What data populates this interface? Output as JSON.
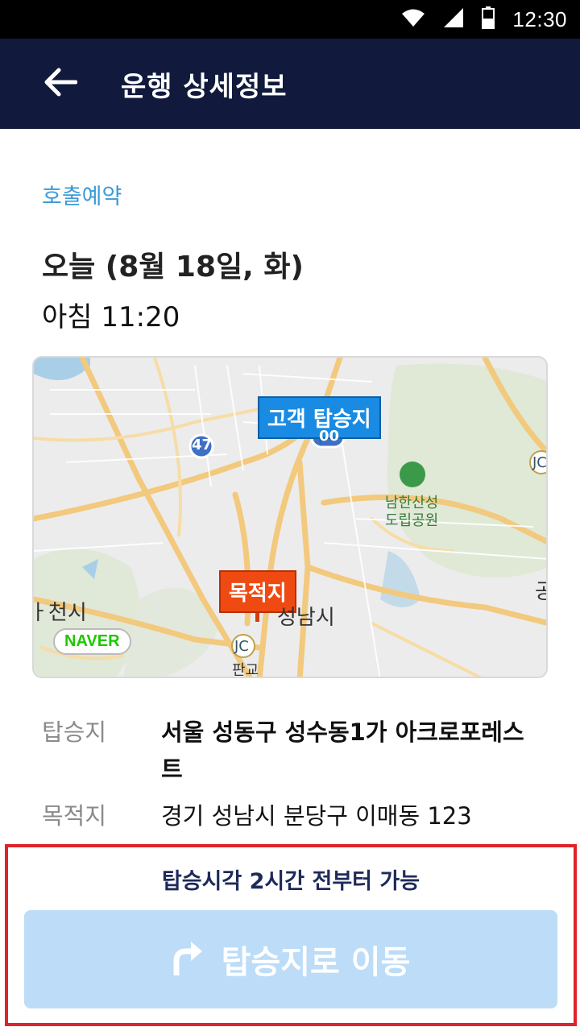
{
  "status_bar": {
    "time": "12:30"
  },
  "app_bar": {
    "title": "운행 상세정보"
  },
  "ride": {
    "type_label": "호출예약",
    "date": "오늘 (8월 18일, 화)",
    "time": "아침 11:20"
  },
  "map": {
    "pickup_label": "고객 탑승지",
    "destination_label": "목적지",
    "places": {
      "city_left": "ㅏ천시",
      "city_center": "성남시",
      "park_line1": "남한산성",
      "park_line2": "도립공원",
      "pangyo": "판교",
      "jc": "JC",
      "route_47": "47",
      "route_100": "00",
      "right_edge": "공"
    },
    "badge": "NAVER"
  },
  "details": {
    "pickup_label": "탑승지",
    "pickup_value": "서울 성동구 성수동1가 아크로포레스트",
    "destination_label": "목적지",
    "destination_value": "경기 성남시 분당구 이매동 123"
  },
  "bottom": {
    "note": "탑승시각 2시간 전부터 가능",
    "button_label": "탑승지로 이동"
  },
  "colors": {
    "app_bar": "#111a3c",
    "accent": "#3a9ad9",
    "pickup": "#1a8be3",
    "destination": "#ef4a12",
    "button_disabled": "#bcdcf8",
    "highlight_border": "#e0222a"
  }
}
